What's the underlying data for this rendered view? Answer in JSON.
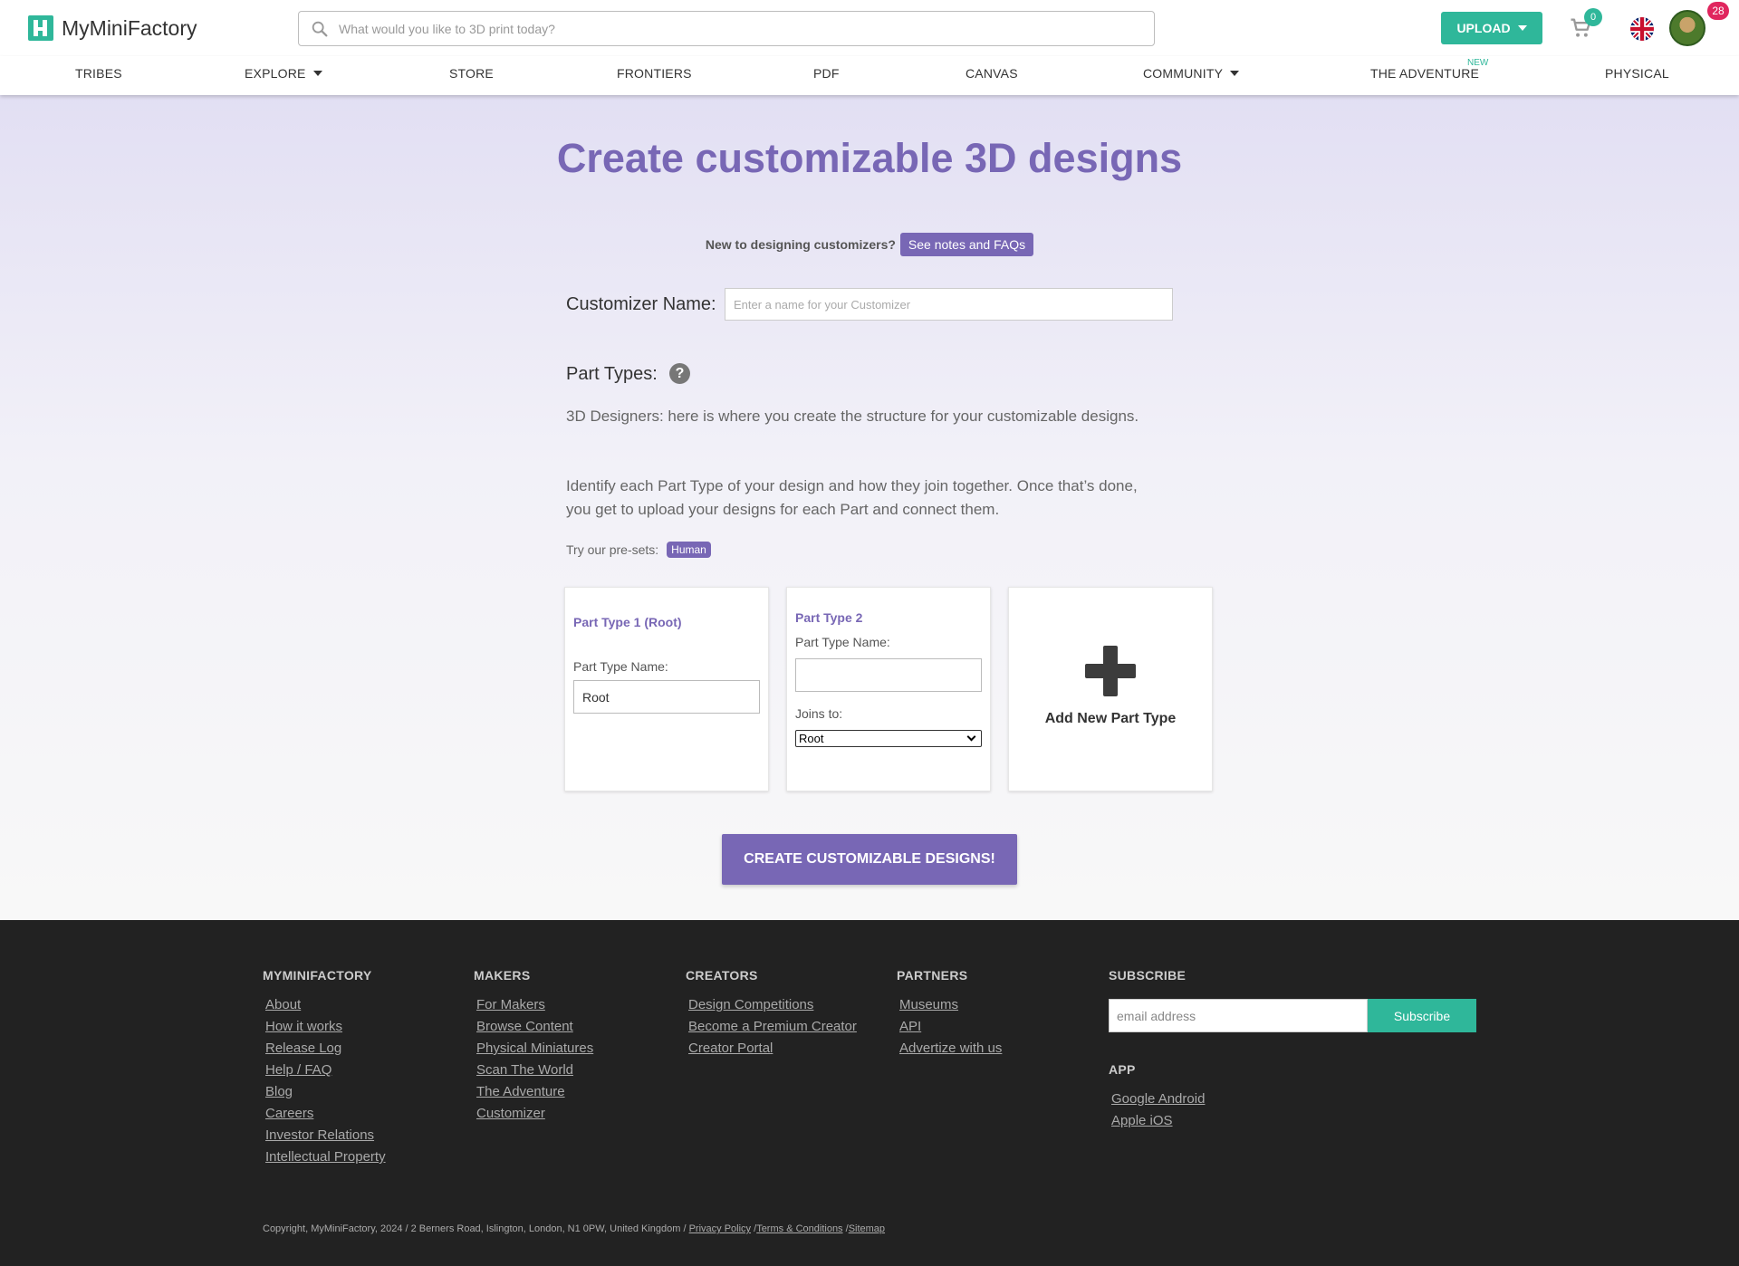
{
  "header": {
    "logo_text": "MyMiniFactory",
    "search_placeholder": "What would you like to 3D print today?",
    "upload_label": "UPLOAD",
    "cart_count": "0",
    "notification_count": "28"
  },
  "nav": {
    "items": [
      {
        "label": "TRIBES"
      },
      {
        "label": "EXPLORE"
      },
      {
        "label": "STORE"
      },
      {
        "label": "FRONTIERS"
      },
      {
        "label": "PDF"
      },
      {
        "label": "CANVAS"
      },
      {
        "label": "COMMUNITY"
      },
      {
        "label": "THE ADVENTURE"
      },
      {
        "label": "PHYSICAL"
      }
    ],
    "new_badge": "NEW"
  },
  "main": {
    "title": "Create customizable 3D designs",
    "faq_prompt": "New to designing customizers?",
    "faq_button": "See notes and FAQs",
    "customizer_name_label": "Customizer Name:",
    "customizer_name_placeholder": "Enter a name for your Customizer",
    "part_types_label": "Part Types:",
    "description_1": "3D Designers: here is where you create the structure for your customizable designs.",
    "description_2": "Identify each Part Type of your design and how they join together. Once that’s done, you get to upload your designs for each Part and connect them.",
    "presets_label": "Try our pre-sets:",
    "preset_chip": "Human",
    "cards": [
      {
        "title": "Part Type 1 (Root)",
        "name_label": "Part Type Name:",
        "name_value": "Root"
      },
      {
        "title": "Part Type 2",
        "name_label": "Part Type Name:",
        "name_value": "",
        "joins_label": "Joins to:",
        "joins_value": "Root"
      }
    ],
    "add_card_label": "Add New Part Type",
    "create_button": "CREATE CUSTOMIZABLE DESIGNS!"
  },
  "footer": {
    "columns": [
      {
        "heading": "MYMINIFACTORY",
        "links": [
          "About",
          "How it works",
          "Release Log",
          "Help / FAQ",
          "Blog",
          "Careers",
          "Investor Relations",
          "Intellectual Property"
        ]
      },
      {
        "heading": "MAKERS",
        "links": [
          "For Makers",
          "Browse Content",
          "Physical Miniatures",
          "Scan The World",
          "The Adventure",
          "Customizer"
        ]
      },
      {
        "heading": "CREATORS",
        "links": [
          "Design Competitions",
          "Become a Premium Creator",
          "Creator Portal"
        ]
      },
      {
        "heading": "PARTNERS",
        "links": [
          "Museums",
          "API",
          "Advertize with us"
        ]
      }
    ],
    "subscribe_heading": "SUBSCRIBE",
    "subscribe_placeholder": "email address",
    "subscribe_button": "Subscribe",
    "app_heading": "APP",
    "app_links": [
      "Google Android",
      "Apple iOS"
    ],
    "copyright": "Copyright, MyMiniFactory, 2024 / 2 Berners Road, Islington, London, N1 0PW, United Kingdom /",
    "legal_links": [
      "Privacy Policy",
      "Terms & Conditions",
      "Sitemap"
    ]
  },
  "colors": {
    "brand_green": "#2fb79a",
    "brand_purple": "#7867b5",
    "footer_bg": "#222222",
    "badge_red": "#e0265e"
  },
  "icons": [
    "search-icon",
    "cart-icon",
    "uk-flag-icon",
    "help-icon",
    "plus-icon",
    "caret-down-icon",
    "chevron-down-icon"
  ]
}
